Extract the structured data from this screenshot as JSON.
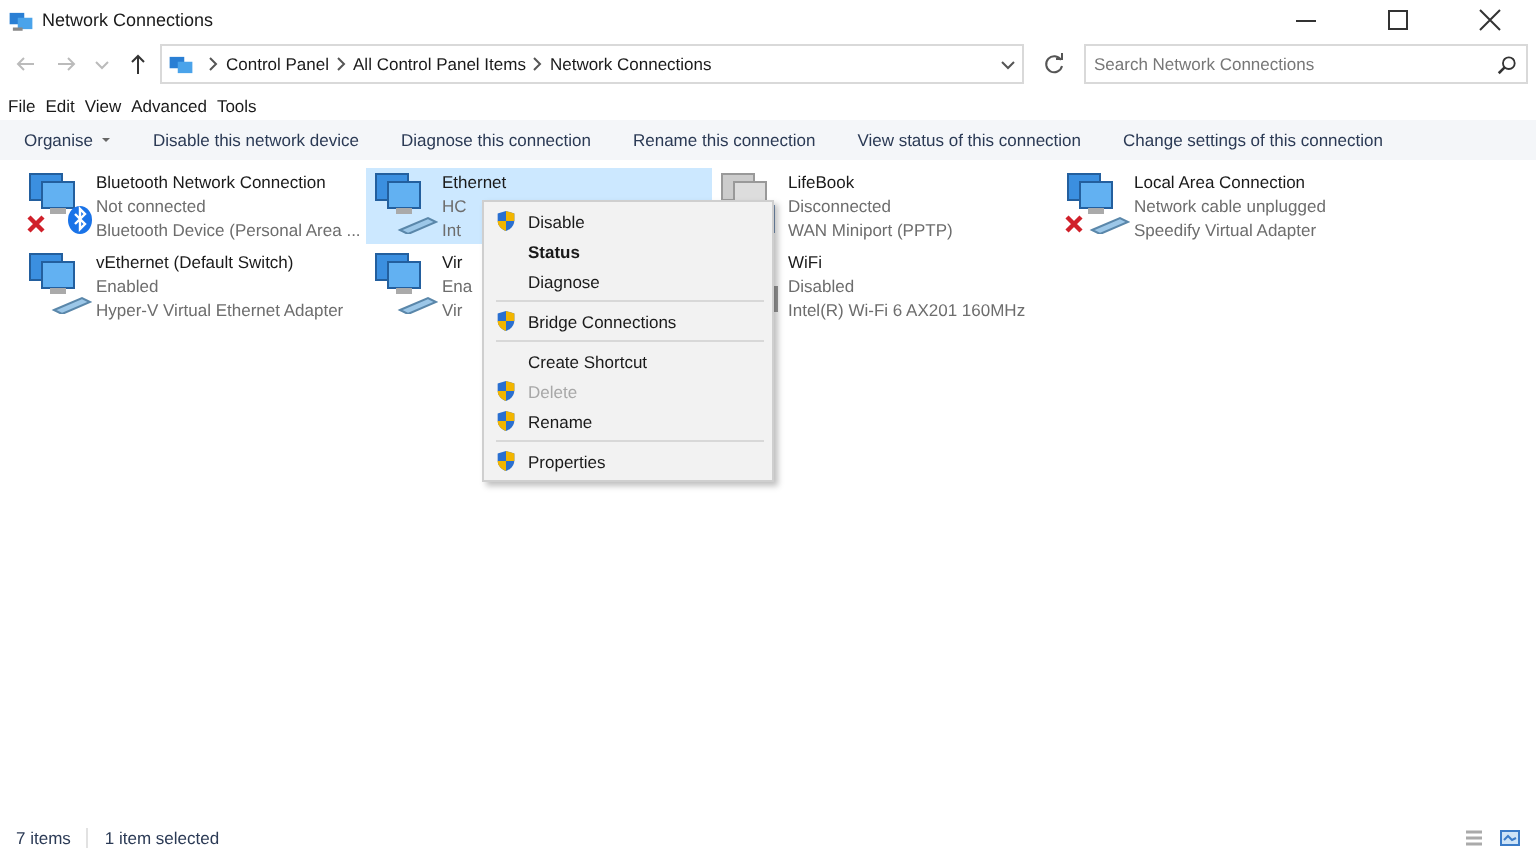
{
  "window": {
    "title": "Network Connections"
  },
  "address": {
    "path": [
      "Control Panel",
      "All Control Panel Items",
      "Network Connections"
    ]
  },
  "search": {
    "placeholder": "Search Network Connections"
  },
  "menu_bar": [
    "File",
    "Edit",
    "View",
    "Advanced",
    "Tools"
  ],
  "command_bar": [
    {
      "label": "Organise",
      "dropdown": true
    },
    {
      "label": "Disable this network device",
      "dropdown": false
    },
    {
      "label": "Diagnose this connection",
      "dropdown": false
    },
    {
      "label": "Rename this connection",
      "dropdown": false
    },
    {
      "label": "View status of this connection",
      "dropdown": false
    },
    {
      "label": "Change settings of this connection",
      "dropdown": false
    }
  ],
  "connections": [
    {
      "name": "Bluetooth Network Connection",
      "status": "Not connected",
      "device": "Bluetooth Device (Personal Area ...",
      "kind": "bluetooth",
      "error": true,
      "selected": false
    },
    {
      "name": "Ethernet",
      "status": "HC",
      "device": "Int",
      "kind": "ethernet",
      "error": false,
      "selected": true
    },
    {
      "name": "LifeBook",
      "status": "Disconnected",
      "device": "WAN Miniport (PPTP)",
      "kind": "wan",
      "error": false,
      "selected": false
    },
    {
      "name": "Local Area Connection",
      "status": "Network cable unplugged",
      "device": "Speedify Virtual Adapter",
      "kind": "ethernet",
      "error": true,
      "selected": false
    },
    {
      "name": "vEthernet (Default Switch)",
      "status": "Enabled",
      "device": "Hyper-V Virtual Ethernet Adapter",
      "kind": "ethernet",
      "error": false,
      "selected": false
    },
    {
      "name": "Vir",
      "status": "Ena",
      "device": "Vir",
      "kind": "ethernet",
      "error": false,
      "selected": false
    },
    {
      "name": "WiFi",
      "status": "Disabled",
      "device": "Intel(R) Wi-Fi 6 AX201 160MHz",
      "kind": "wifi",
      "error": false,
      "selected": false
    }
  ],
  "context_menu": [
    {
      "kind": "item",
      "label": "Disable",
      "shield": true,
      "bold": false,
      "disabled": false
    },
    {
      "kind": "item",
      "label": "Status",
      "shield": false,
      "bold": true,
      "disabled": false
    },
    {
      "kind": "item",
      "label": "Diagnose",
      "shield": false,
      "bold": false,
      "disabled": false
    },
    {
      "kind": "separator"
    },
    {
      "kind": "item",
      "label": "Bridge Connections",
      "shield": true,
      "bold": false,
      "disabled": false
    },
    {
      "kind": "separator"
    },
    {
      "kind": "item",
      "label": "Create Shortcut",
      "shield": false,
      "bold": false,
      "disabled": false
    },
    {
      "kind": "item",
      "label": "Delete",
      "shield": true,
      "bold": false,
      "disabled": true
    },
    {
      "kind": "item",
      "label": "Rename",
      "shield": true,
      "bold": false,
      "disabled": false
    },
    {
      "kind": "separator"
    },
    {
      "kind": "item",
      "label": "Properties",
      "shield": true,
      "bold": false,
      "disabled": false
    }
  ],
  "status_bar": {
    "count": "7 items",
    "selection": "1 item selected"
  }
}
